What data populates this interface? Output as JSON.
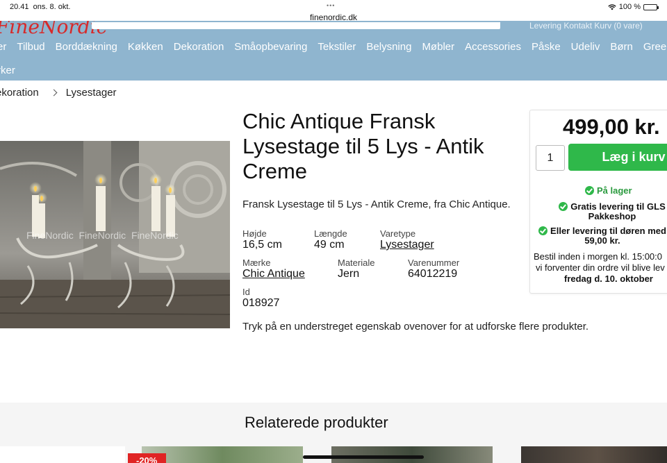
{
  "status_bar": {
    "time": "20.41",
    "date": "ons. 8. okt.",
    "url": "finenordic.dk",
    "battery": "100 %",
    "battery_level": 1.0
  },
  "header": {
    "links_partial": "Levering   Kontakt   Kurv (0 vare)"
  },
  "nav": {
    "items": [
      "er",
      "Tilbud",
      "Borddækning",
      "Køkken",
      "Dekoration",
      "Småopbevaring",
      "Tekstiler",
      "Belysning",
      "Møbler",
      "Accessories",
      "Påske",
      "Udeliv",
      "Børn",
      "GreenGate"
    ],
    "row2": "rker"
  },
  "breadcrumb": {
    "items": [
      "ekoration",
      "Lysestager"
    ]
  },
  "product": {
    "title": "Chic Antique Fransk Lysestage til 5 Lys - Antik Creme",
    "description": "Fransk Lysestage til 5 Lys - Antik Creme, fra Chic Antique.",
    "image_watermark": "FineNordic  FineNordic  FineNordic",
    "attributes": {
      "height": {
        "label": "Højde",
        "value": "16,5 cm"
      },
      "length": {
        "label": "Længde",
        "value": "49 cm"
      },
      "type": {
        "label": "Varetype",
        "value": "Lysestager"
      },
      "brand": {
        "label": "Mærke",
        "value": "Chic Antique"
      },
      "material": {
        "label": "Materiale",
        "value": "Jern"
      },
      "sku": {
        "label": "Varenummer",
        "value": "64012219"
      },
      "id": {
        "label": "Id",
        "value": "018927"
      }
    },
    "hint": "Tryk på en understreget egenskab ovenover for at udforske flere produkter."
  },
  "buybox": {
    "price": "499,00 kr.",
    "quantity": "1",
    "add_to_cart": "Læg i kurv",
    "in_stock": "På lager",
    "free_delivery": "Gratis levering til GLS Pakkeshop",
    "door_delivery": "Eller levering til døren med 59,00 kr.",
    "order_line1": "Bestil inden i morgen kl. 15:00:0",
    "order_line2": "vi forventer din ordre vil blive lev",
    "order_line3": "fredag d. 10. oktober"
  },
  "related": {
    "title": "Relaterede produkter",
    "sale_badge": "-20%"
  },
  "colors": {
    "nav_bg": "#8fb5cf",
    "cart_green": "#2fb84a",
    "sale_red": "#e02424",
    "logo_red": "#d72a2a"
  }
}
